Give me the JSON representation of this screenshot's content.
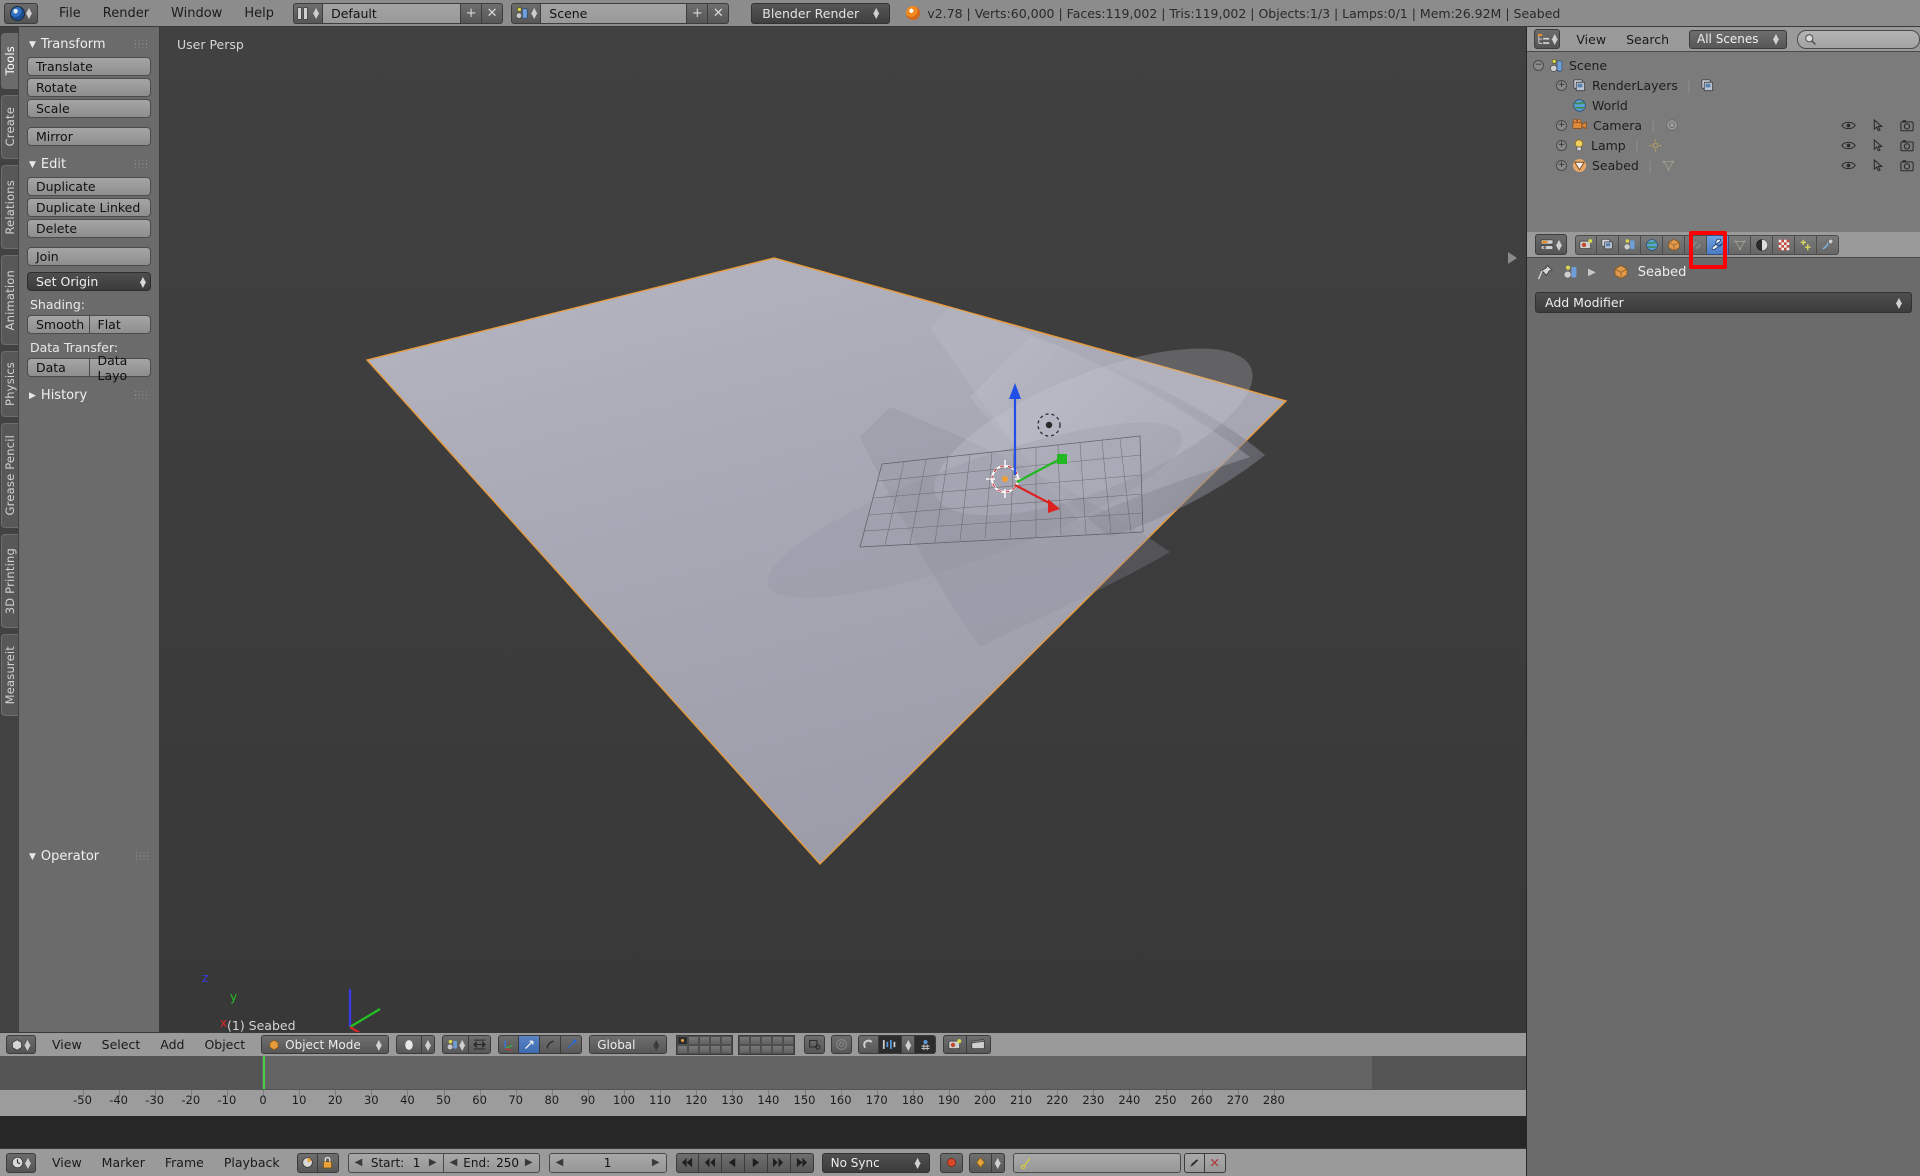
{
  "app": {
    "name": "Blender",
    "version": "v2.78",
    "active_object": "Seabed"
  },
  "topbar": {
    "menus": [
      "File",
      "Render",
      "Window",
      "Help"
    ],
    "screen_layout": "Default",
    "scene_name": "Scene",
    "render_engine": "Blender Render",
    "stats": "v2.78 | Verts:60,000 | Faces:119,002 | Tris:119,002 | Objects:1/3 | Lamps:0/1 | Mem:26.92M | Seabed",
    "stats_parts": {
      "version": "v2.78",
      "verts": "Verts:60,000",
      "faces": "Faces:119,002",
      "tris": "Tris:119,002",
      "objects": "Objects:1/3",
      "lamps": "Lamps:0/1",
      "mem": "Mem:26.92M",
      "object": "Seabed"
    },
    "plus_label": "+",
    "x_label": "✕"
  },
  "toolshelf": {
    "tabs": [
      {
        "label": "Tools",
        "active": true
      },
      {
        "label": "Create",
        "active": false
      },
      {
        "label": "Relations",
        "active": false
      },
      {
        "label": "Animation",
        "active": false
      },
      {
        "label": "Physics",
        "active": false
      },
      {
        "label": "Grease Pencil",
        "active": false
      },
      {
        "label": "3D Printing",
        "active": false
      },
      {
        "label": "Measureit",
        "active": false
      }
    ],
    "panels": {
      "transform": {
        "title": "Transform",
        "buttons": [
          "Translate",
          "Rotate",
          "Scale",
          "Mirror"
        ]
      },
      "edit": {
        "title": "Edit",
        "buttons": [
          "Duplicate",
          "Duplicate Linked",
          "Delete",
          "Join"
        ],
        "set_origin": "Set Origin",
        "shading_label": "Shading:",
        "shading_buttons": [
          "Smooth",
          "Flat"
        ],
        "data_transfer_label": "Data Transfer:",
        "data_transfer_buttons": [
          "Data",
          "Data Layo"
        ]
      },
      "history": {
        "title": "History"
      },
      "operator": {
        "title": "Operator"
      }
    }
  },
  "viewport": {
    "view_label": "User Persp",
    "object_label": "(1) Seabed",
    "axis_gizmo": {
      "x": "x",
      "y": "y",
      "z": "z"
    },
    "colors": {
      "bg_top": "#414141",
      "bg_bottom": "#383838",
      "mesh": "#a8a8b4",
      "outline": "#e89b3c"
    }
  },
  "viewport_header": {
    "menus": [
      "View",
      "Select",
      "Add",
      "Object"
    ],
    "mode": "Object Mode",
    "transform_orientation": "Global"
  },
  "timeline": {
    "menus": [
      "View",
      "Marker",
      "Frame",
      "Playback"
    ],
    "start_label": "Start:",
    "start_value": "1",
    "end_label": "End:",
    "end_value": "250",
    "current_frame": "1",
    "sync_mode": "No Sync",
    "ticks": [
      "-50",
      "-40",
      "-30",
      "-20",
      "-10",
      "0",
      "10",
      "20",
      "30",
      "40",
      "50",
      "60",
      "70",
      "80",
      "90",
      "100",
      "110",
      "120",
      "130",
      "140",
      "150",
      "160",
      "170",
      "180",
      "190",
      "200",
      "210",
      "220",
      "230",
      "240",
      "250",
      "260",
      "270",
      "280"
    ],
    "playhead_frame": "1"
  },
  "outliner": {
    "menus": [
      "View",
      "Search"
    ],
    "display_mode": "All Scenes",
    "search_placeholder": "",
    "tree": [
      {
        "label": "Scene",
        "indent": 0,
        "icon": "scene-icon",
        "expanded": true
      },
      {
        "label": "RenderLayers",
        "indent": 1,
        "icon": "renderlayers-icon",
        "expanded": false
      },
      {
        "label": "World",
        "indent": 2,
        "icon": "world-icon",
        "expanded": null
      },
      {
        "label": "Camera",
        "indent": 1,
        "icon": "camera-icon",
        "expanded": false
      },
      {
        "label": "Lamp",
        "indent": 1,
        "icon": "lamp-icon",
        "expanded": false
      },
      {
        "label": "Seabed",
        "indent": 1,
        "icon": "mesh-icon",
        "expanded": false
      }
    ]
  },
  "properties": {
    "tabs": [
      {
        "name": "render-tab",
        "icon": "camera-back-icon",
        "active": false
      },
      {
        "name": "render-layers-tab",
        "icon": "images-icon",
        "active": false
      },
      {
        "name": "scene-tab",
        "icon": "scene-icon",
        "active": false
      },
      {
        "name": "world-tab",
        "icon": "world-icon",
        "active": false
      },
      {
        "name": "object-tab",
        "icon": "cube-icon",
        "active": false
      },
      {
        "name": "constraints-tab",
        "icon": "chain-icon",
        "active": false
      },
      {
        "name": "modifiers-tab",
        "icon": "wrench-icon",
        "active": true
      },
      {
        "name": "data-tab",
        "icon": "mesh-data-icon",
        "active": false
      },
      {
        "name": "material-tab",
        "icon": "sphere-icon",
        "active": false
      },
      {
        "name": "texture-tab",
        "icon": "checker-icon",
        "active": false
      },
      {
        "name": "particles-tab",
        "icon": "particles-icon",
        "active": false
      },
      {
        "name": "physics-tab",
        "icon": "physics-icon",
        "active": false
      }
    ],
    "breadcrumb_object": "Seabed",
    "add_modifier_label": "Add Modifier",
    "highlight_color": "#ff0000"
  }
}
